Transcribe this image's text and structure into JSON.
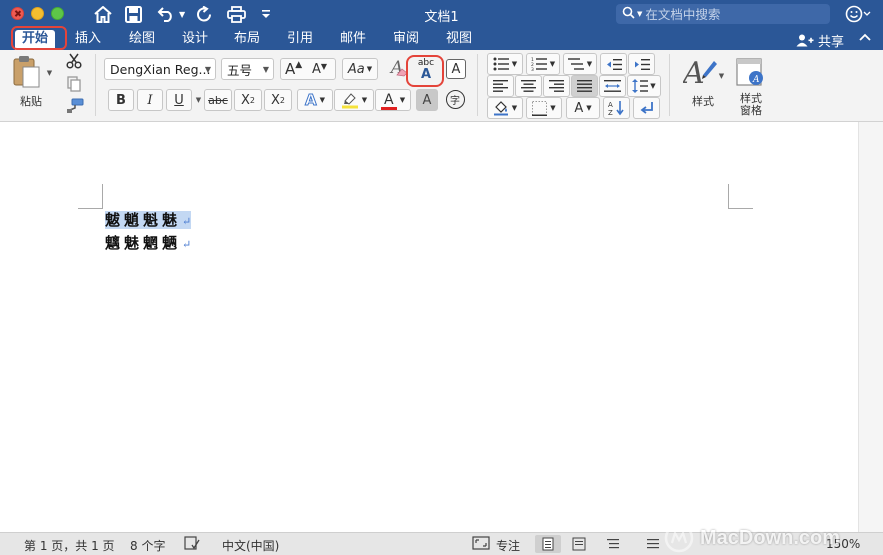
{
  "window": {
    "title": "文档1",
    "search_placeholder": "在文档中搜索"
  },
  "tabs": [
    {
      "label": "开始",
      "active": true
    },
    {
      "label": "插入"
    },
    {
      "label": "绘图"
    },
    {
      "label": "设计"
    },
    {
      "label": "布局"
    },
    {
      "label": "引用"
    },
    {
      "label": "邮件"
    },
    {
      "label": "审阅"
    },
    {
      "label": "视图"
    }
  ],
  "share_label": "共享",
  "ribbon": {
    "paste_label": "粘贴",
    "font_name": "DengXian Reg...",
    "font_size": "五号",
    "phonetic_label": "abc",
    "phonetic_letter": "A",
    "char_border_letter": "A",
    "enlarge_letter": "A",
    "shrink_letter": "A",
    "change_case_letter": "Aa",
    "clear_letter": "A",
    "bold": "B",
    "italic": "I",
    "underline": "U",
    "strike": "abc",
    "subscript": "X",
    "subscript_mark": "2",
    "superscript": "X",
    "superscript_mark": "2",
    "text_effect_letter": "A",
    "font_color_letter": "A",
    "char_shading_letter": "A",
    "enclose_char": "字",
    "styles_label": "样式",
    "styles_pane_label_1": "样式",
    "styles_pane_label_2": "窗格",
    "colors": {
      "accent": "#2b5797",
      "highlight_red": "#e4443a",
      "highlight_yellow": "#f5e23b",
      "font_red": "#e02020"
    }
  },
  "document": {
    "line1": "魃魈魁魅",
    "line2": "魑魅魍魉"
  },
  "status": {
    "page": "第 1 页，共 1 页",
    "words": "8 个字",
    "language": "中文(中国)",
    "focus": "专注",
    "zoom": "150%"
  },
  "watermark": "MacDown.com"
}
